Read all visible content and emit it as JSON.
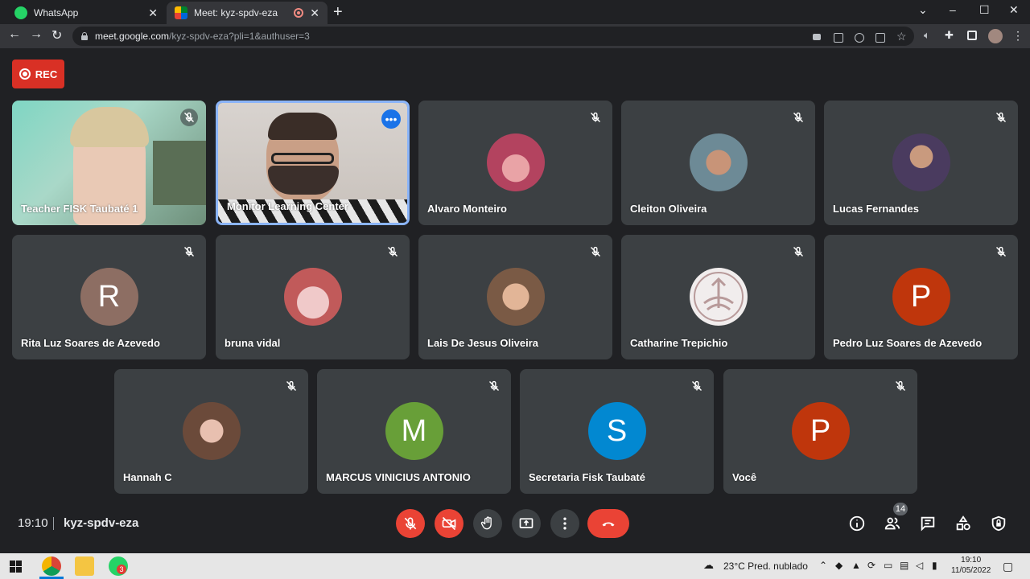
{
  "browser": {
    "tabs": [
      {
        "title": "WhatsApp",
        "active": false
      },
      {
        "title": "Meet: kyz-spdv-eza",
        "active": true
      }
    ],
    "url_host": "meet.google.com",
    "url_path": "/kyz-spdv-eza?pli=1&authuser=3"
  },
  "recording": {
    "label": "REC"
  },
  "participants": [
    {
      "name": "Teacher FISK Taubaté 1",
      "type": "video",
      "muted": true
    },
    {
      "name": "Monitor Learning Center",
      "type": "video",
      "muted": false,
      "selected": true
    },
    {
      "name": "Alvaro Monteiro",
      "type": "photo",
      "muted": true,
      "avatar_color": "#b3435f"
    },
    {
      "name": "Cleiton Oliveira",
      "type": "photo",
      "muted": true,
      "avatar_color": "#6d8a96"
    },
    {
      "name": "Lucas Fernandes",
      "type": "photo",
      "muted": true,
      "avatar_color": "#4a3b5f"
    },
    {
      "name": "Rita Luz Soares de Azevedo",
      "type": "initial",
      "initial": "R",
      "muted": true,
      "avatar_color": "#8d6e63"
    },
    {
      "name": "bruna vidal",
      "type": "photo",
      "muted": true,
      "avatar_color": "#c15a5a"
    },
    {
      "name": "Lais De Jesus Oliveira",
      "type": "photo",
      "muted": true,
      "avatar_color": "#7a5a45"
    },
    {
      "name": "Catharine Trepichio",
      "type": "photo",
      "muted": true,
      "avatar_color": "#f1eded"
    },
    {
      "name": "Pedro Luz Soares de Azevedo",
      "type": "initial",
      "initial": "P",
      "muted": true,
      "avatar_color": "#bf360c"
    },
    {
      "name": "Hannah C",
      "type": "photo",
      "muted": true,
      "avatar_color": "#6b4a3a"
    },
    {
      "name": "MARCUS VINICIUS ANTONIO",
      "type": "initial",
      "initial": "M",
      "muted": true,
      "avatar_color": "#689f38"
    },
    {
      "name": "Secretaria Fisk Taubaté",
      "type": "initial",
      "initial": "S",
      "muted": true,
      "avatar_color": "#0288d1"
    },
    {
      "name": "Você",
      "type": "initial",
      "initial": "P",
      "muted": true,
      "avatar_color": "#bf360c"
    }
  ],
  "bottom_bar": {
    "time": "19:10",
    "meeting_code": "kyz-spdv-eza",
    "participant_count": "14"
  },
  "taskbar": {
    "whatsapp_badge": "3",
    "weather": "23°C  Pred. nublado",
    "time": "19:10",
    "date": "11/05/2022"
  },
  "colors": {
    "background": "#202124",
    "tile": "#3c4043",
    "danger": "#ea4335",
    "accent": "#8ab4f8"
  }
}
